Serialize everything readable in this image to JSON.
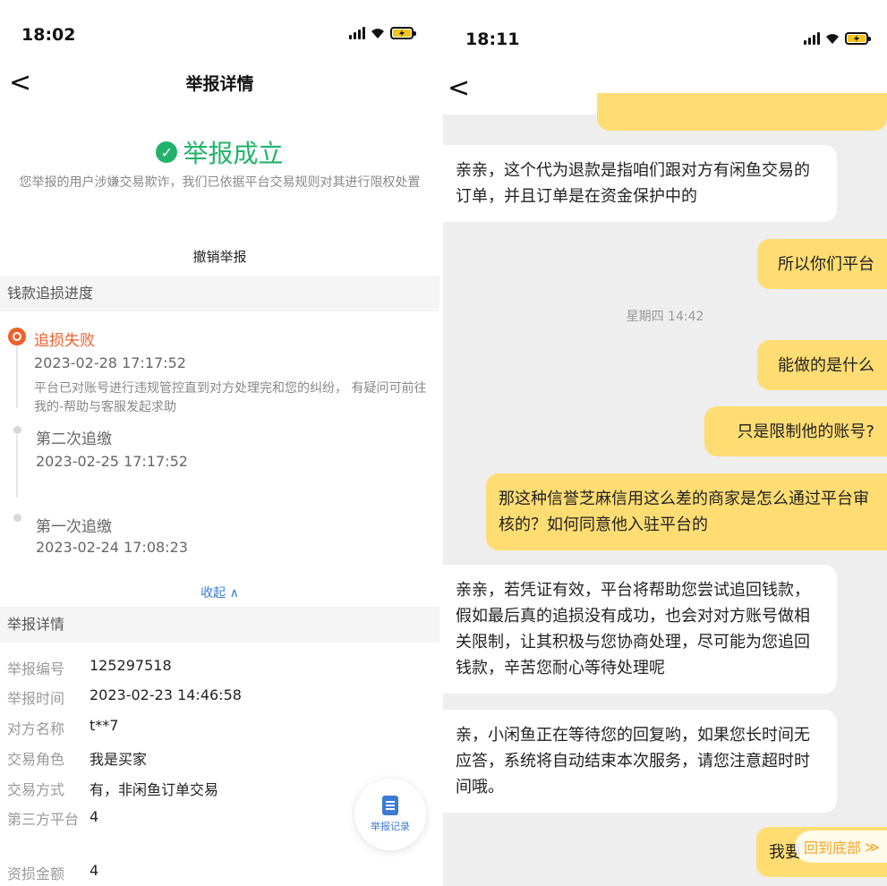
{
  "left": {
    "status_time": "18:02",
    "nav_title": "举报详情",
    "back_glyph": "<",
    "success_title": "举报成立",
    "success_desc": "您举报的用户涉嫌交易欺诈，我们已依据平台交易规则对其进行限权处置",
    "revoke_label": "撤销举报",
    "progress_header": "钱款追损进度",
    "timeline": [
      {
        "title": "追损失败",
        "date": "2023-02-28 17:17:52",
        "note": "平台已对账号进行违规管控直到对方处理完和您的纠纷， 有疑问可前往我的-帮助与客服发起求助",
        "status": "fail"
      },
      {
        "title": "第二次追缴",
        "date": "2023-02-25 17:17:52",
        "status": "done"
      },
      {
        "title": "第一次追缴",
        "date": "2023-02-24 17:08:23",
        "status": "done"
      }
    ],
    "collapse_label": "收起 ∧",
    "detail_header": "举报详情",
    "details": [
      {
        "k": "举报编号",
        "v": "125297518"
      },
      {
        "k": "举报时间",
        "v": "2023-02-23 14:46:58"
      },
      {
        "k": "对方名称",
        "v": "t**7"
      },
      {
        "k": "交易角色",
        "v": "我是买家"
      },
      {
        "k": "交易方式",
        "v": "有，非闲鱼订单交易"
      },
      {
        "k": "第三方平台",
        "v": "4"
      },
      {
        "k": "资损金额",
        "v": "4"
      }
    ],
    "float_button_label": "举报记录",
    "colors": {
      "success": "#21b36b",
      "fail": "#f0602c",
      "link": "#3a7bd5"
    }
  },
  "right": {
    "status_time": "18:11",
    "back_glyph": "<",
    "messages": [
      {
        "side": "in",
        "text": "亲亲，这个代为退款是指咱们跟对方有闲鱼交易的订单，并且订单是在资金保护中的"
      },
      {
        "side": "out",
        "text": "所以你们平台"
      },
      {
        "side": "ts",
        "text": "星期四 14:42"
      },
      {
        "side": "out",
        "text": "能做的是什么"
      },
      {
        "side": "out",
        "text": "只是限制他的账号?"
      },
      {
        "side": "out",
        "text": "那这种信誉芝麻信用这么差的商家是怎么通过平台审核的？如何同意他入驻平台的"
      },
      {
        "side": "in",
        "text": "亲亲，若凭证有效，平台将帮助您尝试追回钱款，假如最后真的追损没有成功，也会对对方账号做相关限制，让其积极与您协商处理，尽可能为您追回钱款，辛苦您耐心等待处理呢"
      },
      {
        "side": "in",
        "text": "亲，小闲鱼正在等待您的回复哟，如果您长时间无应答，系统将自动结束本次服务，请您注意超时时间哦。"
      },
      {
        "side": "out",
        "text": "我要"
      }
    ],
    "goto_bottom_label": "回到底部",
    "goto_bottom_glyph": "≫",
    "colors": {
      "out_bubble": "#ffdd73",
      "in_bubble": "#ffffff",
      "accent": "#f5a623"
    }
  }
}
